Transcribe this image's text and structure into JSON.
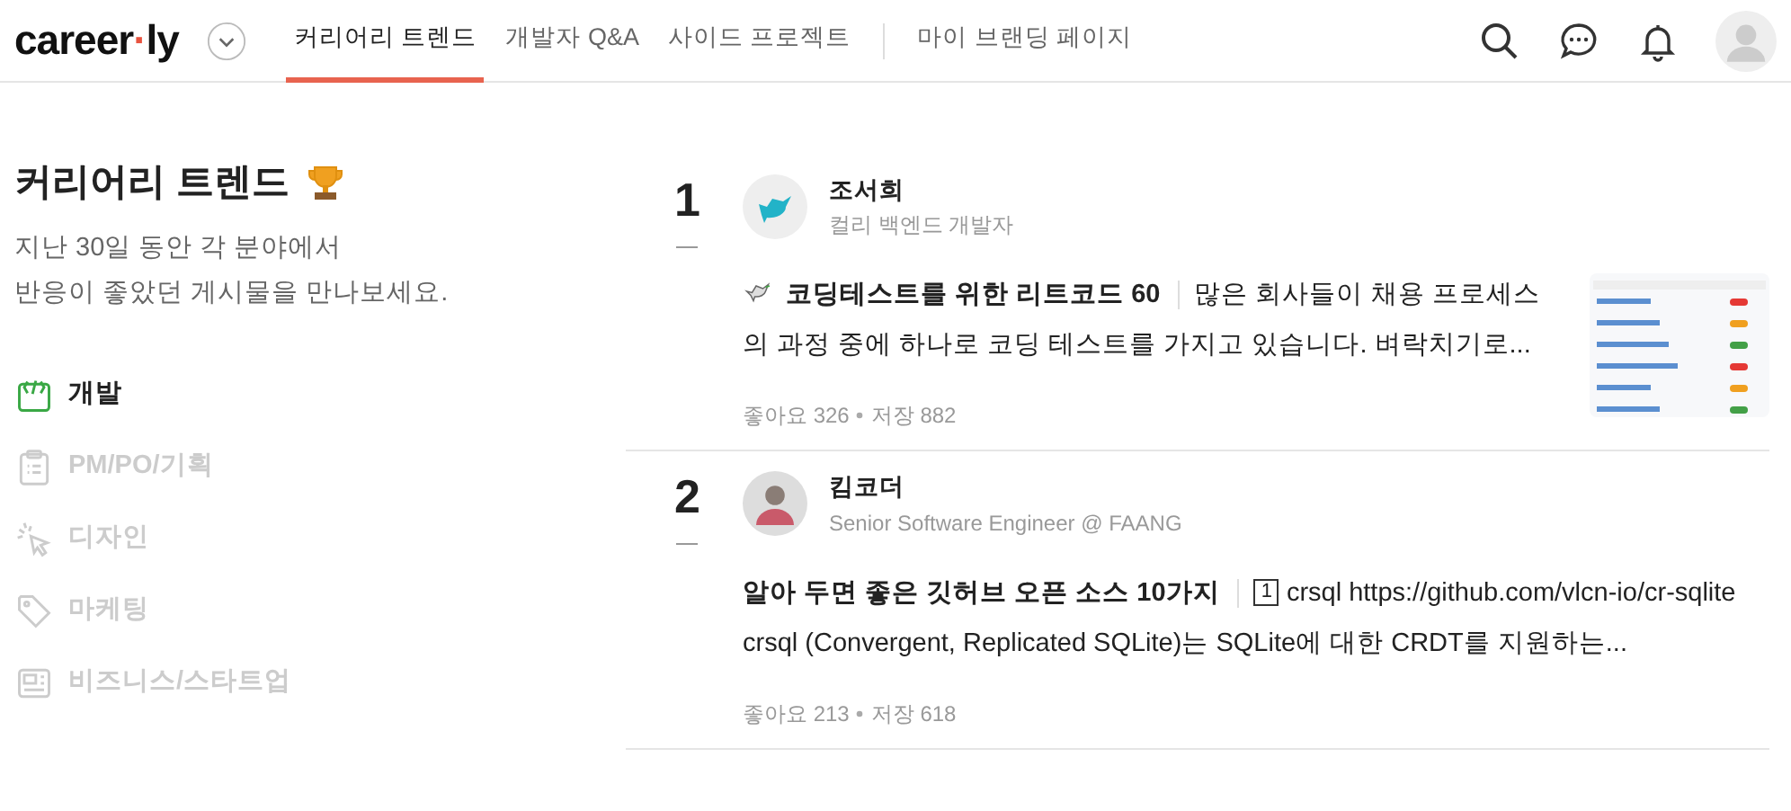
{
  "header": {
    "logo": {
      "left": "career",
      "dot": "·",
      "right": "ly"
    },
    "tabs": [
      {
        "label": "커리어리 트렌드",
        "selected": true,
        "divider_before": false
      },
      {
        "label": "개발자 Q&A",
        "selected": false,
        "divider_before": false
      },
      {
        "label": "사이드 프로젝트",
        "selected": false,
        "divider_before": false
      },
      {
        "label": "마이 브랜딩 페이지",
        "selected": false,
        "divider_before": true
      }
    ]
  },
  "sidebar": {
    "title": "커리어리 트렌드",
    "subtitle_lines": [
      "지난 30일 동안 각 분야에서",
      "반응이 좋았던 게시물을 만나보세요."
    ],
    "categories": [
      {
        "label": "개발",
        "kind": "code",
        "selected": true
      },
      {
        "label": "PM/PO/기획",
        "kind": "clipboard",
        "selected": false
      },
      {
        "label": "디자인",
        "kind": "cursor",
        "selected": false
      },
      {
        "label": "마케팅",
        "kind": "tag",
        "selected": false
      },
      {
        "label": "비즈니스/스타트업",
        "kind": "news",
        "selected": false
      }
    ]
  },
  "posts": [
    {
      "rank": "1",
      "author": "조서희",
      "author_title": "컬리 백엔드 개발자",
      "avatar": {
        "kind": "icon"
      },
      "title_icon": true,
      "title": "코딩테스트를 위한 리트코드 60",
      "excerpt": "많은 회사들이 채용 프로세스의 과정 중에 하나로 코딩 테스트를 가지고 있습니다. 벼락치기로...",
      "likes": "좋아요 326",
      "saves": "저장 882"
    },
    {
      "rank": "2",
      "author": "킴코더",
      "author_title": "Senior Software Engineer @ FAANG",
      "title_icon": false,
      "title": "알아 두면 좋은 깃허브 오픈 소스 10가지",
      "excerpt_badge": "1",
      "excerpt": "crsql https://github.com/vlcn-io/cr-sqlite crsql (Convergent, Replicated SQLite)는 SQLite에 대한 CRDT를 지원하는...",
      "likes": "좋아요 213",
      "saves": "저장 618"
    }
  ]
}
